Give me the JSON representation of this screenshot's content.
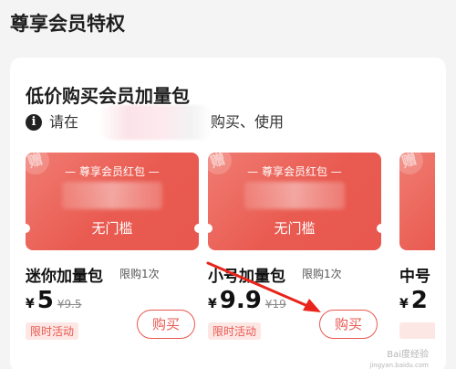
{
  "page": {
    "title": "尊享会员特权"
  },
  "card": {
    "title": "低价购买会员加量包",
    "notice_prefix": "请在",
    "notice_suffix": "购买、使用",
    "notice_icon": "info-icon"
  },
  "packages": [
    {
      "voucher_title": "— 尊享会员红包 —",
      "voucher_stamp": "赠",
      "voucher_condition": "无门槛",
      "name": "迷你加量包",
      "limit": "限购1次",
      "currency": "¥",
      "price": "5",
      "old_price": "¥9.5",
      "tag": "限时活动",
      "buy_label": "购买"
    },
    {
      "voucher_title": "— 尊享会员红包 —",
      "voucher_stamp": "赠",
      "voucher_condition": "无门槛",
      "name": "小号加量包",
      "limit": "限购1次",
      "currency": "¥",
      "price": "9.9",
      "old_price": "¥19",
      "tag": "限时活动",
      "buy_label": "购买"
    },
    {
      "voucher_stamp": "赠",
      "name": "中号",
      "currency": "¥",
      "price": "2"
    }
  ],
  "watermark": {
    "main": "Bai度经验",
    "sub": "jingyan.baidu.com"
  },
  "colors": {
    "accent": "#e8584f",
    "voucher_light": "#f07c72",
    "tag_bg": "#fde7e5",
    "annotation_arrow": "#e8241b"
  }
}
